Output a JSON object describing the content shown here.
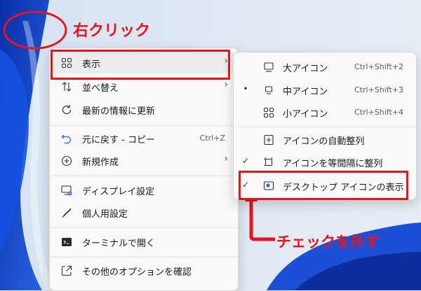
{
  "annotations": {
    "right_click": "右クリック",
    "uncheck": "チェックを外す"
  },
  "context_menu": {
    "items": [
      {
        "label": "表示",
        "icon": "grid-icon",
        "has_submenu": true
      },
      {
        "label": "並べ替え",
        "icon": "sort-icon",
        "has_submenu": true
      },
      {
        "label": "最新の情報に更新",
        "icon": "refresh-icon"
      },
      {
        "label": "元に戻す - コピー",
        "icon": "undo-icon",
        "shortcut": "Ctrl+Z"
      },
      {
        "label": "新規作成",
        "icon": "new-icon",
        "has_submenu": true
      },
      {
        "label": "ディスプレイ設定",
        "icon": "display-settings-icon"
      },
      {
        "label": "個人用設定",
        "icon": "personalize-icon"
      },
      {
        "label": "ターミナルで開く",
        "icon": "terminal-icon"
      },
      {
        "label": "その他のオプションを確認",
        "icon": "more-options-icon"
      }
    ],
    "arrow": "›"
  },
  "view_submenu": {
    "items": [
      {
        "label": "大アイコン",
        "icon": "large-icons-icon",
        "shortcut": "Ctrl+Shift+2",
        "mark": ""
      },
      {
        "label": "中アイコン",
        "icon": "medium-icons-icon",
        "shortcut": "Ctrl+Shift+3",
        "mark": "•"
      },
      {
        "label": "小アイコン",
        "icon": "small-icons-icon",
        "shortcut": "Ctrl+Shift+4",
        "mark": ""
      },
      {
        "label": "アイコンの自動整列",
        "icon": "auto-arrange-icon",
        "mark": ""
      },
      {
        "label": "アイコンを等間隔に整列",
        "icon": "align-grid-icon",
        "mark": "✓"
      },
      {
        "label": "デスクトップ アイコンの表示",
        "icon": "show-desktop-icons-icon",
        "mark": "✓"
      }
    ]
  },
  "colors": {
    "annotation_red": "#e8141b",
    "wallpaper_blue": "#1340c8",
    "wallpaper_light": "#dfe8f3"
  }
}
